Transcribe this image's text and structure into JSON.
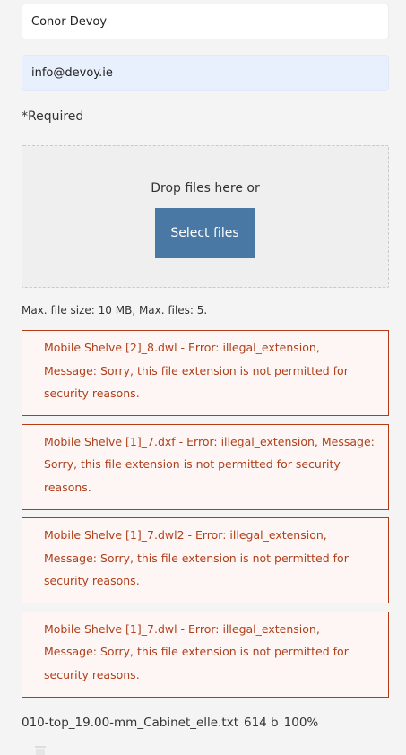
{
  "form": {
    "name_value": "Conor Devoy",
    "email_value": "info@devoy.ie",
    "required_note": "*Required"
  },
  "upload": {
    "drop_text": "Drop files here or",
    "select_button": "Select files",
    "limits": "Max. file size: 10 MB, Max. files: 5."
  },
  "errors": [
    {
      "message": "Mobile Shelve [2]_8.dwl - Error: illegal_extension, Message: Sorry, this file extension is not permitted for security reasons."
    },
    {
      "message": "Mobile Shelve [1]_7.dxf - Error: illegal_extension, Message: Sorry, this file extension is not permitted for security reasons."
    },
    {
      "message": "Mobile Shelve [1]_7.dwl2 - Error: illegal_extension, Message: Sorry, this file extension is not permitted for security reasons."
    },
    {
      "message": "Mobile Shelve [1]_7.dwl - Error: illegal_extension, Message: Sorry, this file extension is not permitted for security reasons."
    }
  ],
  "uploaded_file": {
    "name": "010-top_19.00-mm_Cabinet_elle.txt",
    "size": "614 b",
    "progress": "100%"
  },
  "colors": {
    "button": "#4a78a4",
    "error_border": "#b83a14",
    "error_text": "#b0401b",
    "autofill": "#e8f0fe"
  },
  "icons": {
    "delete": "trash-icon"
  }
}
